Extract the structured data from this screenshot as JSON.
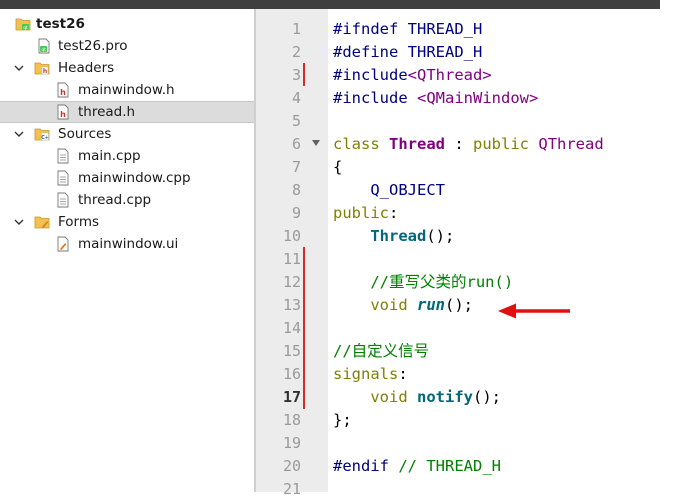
{
  "project_tree": {
    "root": {
      "label": "test26"
    },
    "pro_file": {
      "label": "test26.pro"
    },
    "headers": {
      "label": "Headers",
      "files": [
        "mainwindow.h",
        "thread.h"
      ]
    },
    "sources": {
      "label": "Sources",
      "files": [
        "main.cpp",
        "mainwindow.cpp",
        "thread.cpp"
      ]
    },
    "forms": {
      "label": "Forms",
      "files": [
        "mainwindow.ui"
      ]
    },
    "selected_file": "thread.h"
  },
  "editor": {
    "current_line": "17",
    "lines": [
      {
        "num": "1",
        "tokens": [
          [
            "kw-pre",
            "#ifndef"
          ],
          [
            "plain",
            " "
          ],
          [
            "macro",
            "THREAD_H"
          ]
        ]
      },
      {
        "num": "2",
        "tokens": [
          [
            "kw-pre",
            "#define"
          ],
          [
            "plain",
            " "
          ],
          [
            "macro",
            "THREAD_H"
          ]
        ]
      },
      {
        "num": "3",
        "tokens": [
          [
            "kw-pre",
            "#include"
          ],
          [
            "kw-inc",
            "<QThread>"
          ]
        ]
      },
      {
        "num": "4",
        "tokens": [
          [
            "kw-pre",
            "#include"
          ],
          [
            "plain",
            " "
          ],
          [
            "kw-inc",
            "<QMainWindow>"
          ]
        ]
      },
      {
        "num": "5",
        "tokens": []
      },
      {
        "num": "6",
        "tokens": [
          [
            "kw",
            "class"
          ],
          [
            "plain",
            " "
          ],
          [
            "ident",
            "Thread"
          ],
          [
            "plain",
            " : "
          ],
          [
            "kw",
            "public"
          ],
          [
            "plain",
            " "
          ],
          [
            "type",
            "QThread"
          ]
        ]
      },
      {
        "num": "7",
        "tokens": [
          [
            "plain",
            "{"
          ]
        ]
      },
      {
        "num": "8",
        "tokens": [
          [
            "plain",
            "    "
          ],
          [
            "macro",
            "Q_OBJECT"
          ]
        ]
      },
      {
        "num": "9",
        "tokens": [
          [
            "kw",
            "public"
          ],
          [
            "plain",
            ":"
          ]
        ]
      },
      {
        "num": "10",
        "tokens": [
          [
            "plain",
            "    "
          ],
          [
            "fn",
            "Thread"
          ],
          [
            "plain",
            "();"
          ]
        ]
      },
      {
        "num": "11",
        "tokens": []
      },
      {
        "num": "12",
        "tokens": [
          [
            "plain",
            "    "
          ],
          [
            "cmt",
            "//重写父类的run()"
          ]
        ]
      },
      {
        "num": "13",
        "tokens": [
          [
            "plain",
            "    "
          ],
          [
            "kw",
            "void"
          ],
          [
            "plain",
            " "
          ],
          [
            "fn-i",
            "run"
          ],
          [
            "plain",
            "();"
          ]
        ]
      },
      {
        "num": "14",
        "tokens": []
      },
      {
        "num": "15",
        "tokens": [
          [
            "cmt",
            "//自定义信号"
          ]
        ]
      },
      {
        "num": "16",
        "tokens": [
          [
            "kw",
            "signals"
          ],
          [
            "plain",
            ":"
          ]
        ]
      },
      {
        "num": "17",
        "tokens": [
          [
            "plain",
            "    "
          ],
          [
            "kw",
            "void"
          ],
          [
            "plain",
            " "
          ],
          [
            "fn",
            "notify"
          ],
          [
            "plain",
            "();"
          ]
        ]
      },
      {
        "num": "18",
        "tokens": [
          [
            "plain",
            "};"
          ]
        ]
      },
      {
        "num": "19",
        "tokens": []
      },
      {
        "num": "20",
        "tokens": [
          [
            "kw-pre",
            "#endif"
          ],
          [
            "plain",
            " "
          ],
          [
            "cmt",
            "// THREAD_H"
          ]
        ]
      },
      {
        "num": "21",
        "tokens": []
      }
    ]
  },
  "colors": {
    "change_marker": "#d42b2b",
    "arrow": "#e01010",
    "selection": "#dcdcdc"
  }
}
